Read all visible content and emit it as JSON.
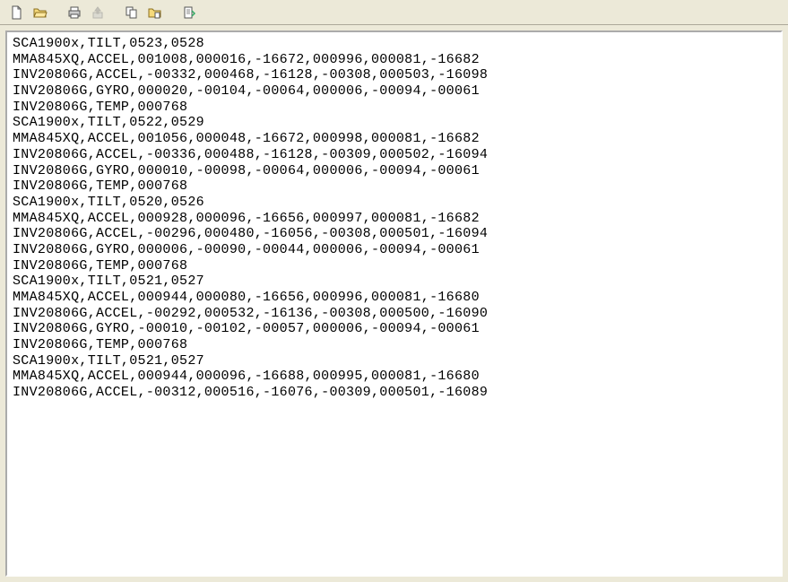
{
  "toolbar": {
    "icons": [
      "new-file-icon",
      "open-folder-icon",
      "print-icon",
      "upload-icon",
      "copy-icon",
      "paste-folder-icon",
      "properties-icon"
    ]
  },
  "terminal": {
    "lines": [
      "SCA1900x,TILT,0523,0528",
      "MMA845XQ,ACCEL,001008,000016,-16672,000996,000081,-16682",
      "INV20806G,ACCEL,-00332,000468,-16128,-00308,000503,-16098",
      "INV20806G,GYRO,000020,-00104,-00064,000006,-00094,-00061",
      "INV20806G,TEMP,000768",
      "SCA1900x,TILT,0522,0529",
      "MMA845XQ,ACCEL,001056,000048,-16672,000998,000081,-16682",
      "INV20806G,ACCEL,-00336,000488,-16128,-00309,000502,-16094",
      "INV20806G,GYRO,000010,-00098,-00064,000006,-00094,-00061",
      "INV20806G,TEMP,000768",
      "SCA1900x,TILT,0520,0526",
      "MMA845XQ,ACCEL,000928,000096,-16656,000997,000081,-16682",
      "INV20806G,ACCEL,-00296,000480,-16056,-00308,000501,-16094",
      "INV20806G,GYRO,000006,-00090,-00044,000006,-00094,-00061",
      "INV20806G,TEMP,000768",
      "SCA1900x,TILT,0521,0527",
      "MMA845XQ,ACCEL,000944,000080,-16656,000996,000081,-16680",
      "INV20806G,ACCEL,-00292,000532,-16136,-00308,000500,-16090",
      "INV20806G,GYRO,-00010,-00102,-00057,000006,-00094,-00061",
      "INV20806G,TEMP,000768",
      "SCA1900x,TILT,0521,0527",
      "MMA845XQ,ACCEL,000944,000096,-16688,000995,000081,-16680",
      "INV20806G,ACCEL,-00312,000516,-16076,-00309,000501,-16089"
    ]
  }
}
